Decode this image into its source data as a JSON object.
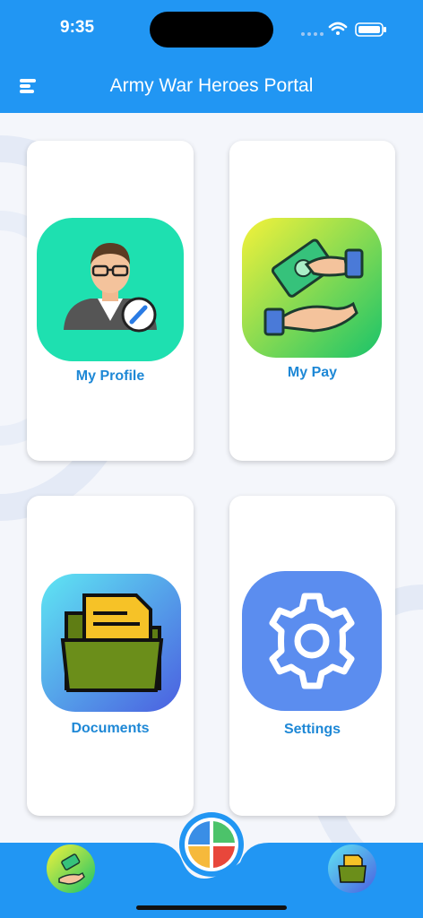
{
  "status_bar": {
    "time": "9:35"
  },
  "header": {
    "title": "Army War Heroes Portal",
    "menu_icon": "menu-icon"
  },
  "cards": [
    {
      "label": "My Profile",
      "icon": "profile-icon",
      "tile_color": "#1ee0b0"
    },
    {
      "label": "My Pay",
      "icon": "pay-icon",
      "tile_color": "#2ecc71"
    },
    {
      "label": "Documents",
      "icon": "documents-icon",
      "tile_color": "#3f8bf0"
    },
    {
      "label": "Settings",
      "icon": "settings-icon",
      "tile_color": "#5b8def"
    }
  ],
  "bottom_nav": {
    "left_icon": "pay-icon",
    "center_icon": "home-grid-icon",
    "right_icon": "documents-icon"
  },
  "colors": {
    "primary": "#2196f3",
    "label": "#1e88d6"
  }
}
